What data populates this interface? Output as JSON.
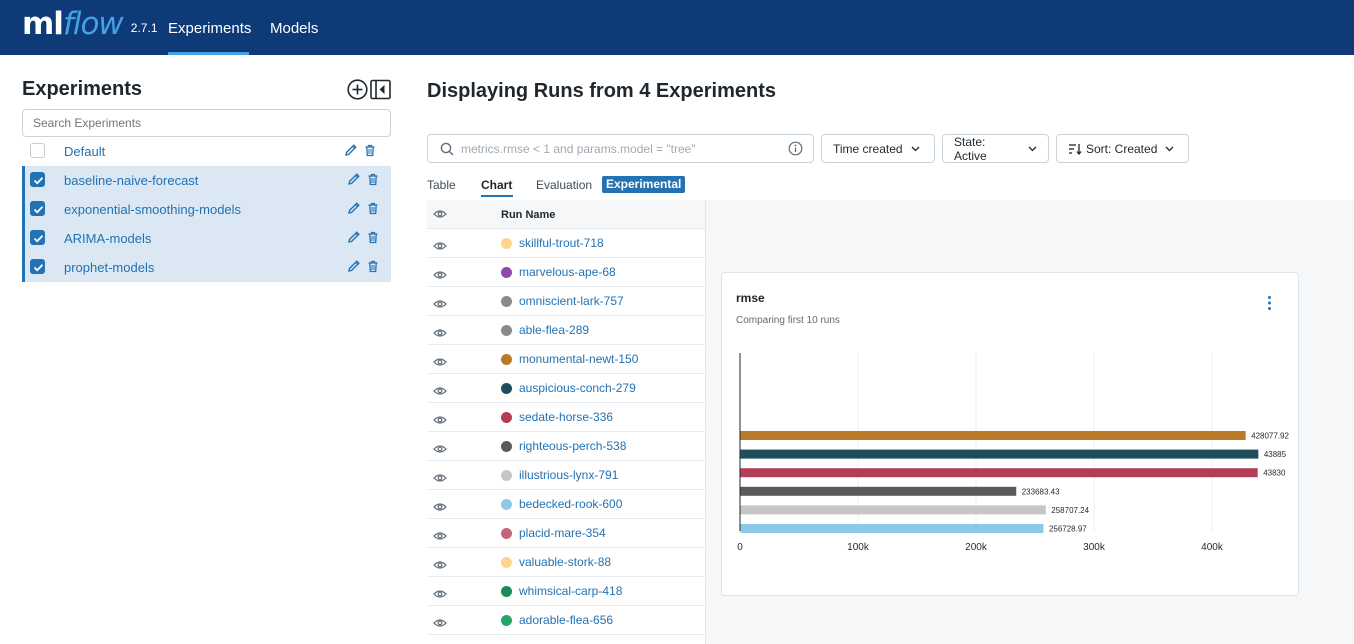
{
  "app": {
    "logo_ml": "ml",
    "logo_flow": "flow",
    "version": "2.7.1"
  },
  "nav": {
    "experiments": "Experiments",
    "models": "Models"
  },
  "sidebar": {
    "title": "Experiments",
    "search_placeholder": "Search Experiments",
    "experiments": [
      {
        "name": "Default",
        "checked": false
      },
      {
        "name": "baseline-naive-forecast",
        "checked": true
      },
      {
        "name": "exponential-smoothing-models",
        "checked": true
      },
      {
        "name": "ARIMA-models",
        "checked": true
      },
      {
        "name": "prophet-models",
        "checked": true
      }
    ]
  },
  "main": {
    "title": "Displaying Runs from 4 Experiments",
    "filter_placeholder": "metrics.rmse < 1 and params.model = \"tree\"",
    "dropdowns": {
      "time": "Time created",
      "state": "State: Active",
      "sort": "Sort: Created"
    },
    "tabs": {
      "table": "Table",
      "chart": "Chart",
      "evaluation": "Evaluation",
      "experimental": "Experimental"
    }
  },
  "runs": {
    "column_header": "Run Name",
    "rows": [
      {
        "name": "skillful-trout-718",
        "color": "#fdd591"
      },
      {
        "name": "marvelous-ape-68",
        "color": "#8d4aa8"
      },
      {
        "name": "omniscient-lark-757",
        "color": "#8a8a8a"
      },
      {
        "name": "able-flea-289",
        "color": "#8a8a8a"
      },
      {
        "name": "monumental-newt-150",
        "color": "#b97a27"
      },
      {
        "name": "auspicious-conch-279",
        "color": "#1f4d5c"
      },
      {
        "name": "sedate-horse-336",
        "color": "#b33d55"
      },
      {
        "name": "righteous-perch-538",
        "color": "#5a5a5a"
      },
      {
        "name": "illustrious-lynx-791",
        "color": "#c6c6c6"
      },
      {
        "name": "bedecked-rook-600",
        "color": "#8ec8e8"
      },
      {
        "name": "placid-mare-354",
        "color": "#c0687a"
      },
      {
        "name": "valuable-stork-88",
        "color": "#fdd591"
      },
      {
        "name": "whimsical-carp-418",
        "color": "#1a8a57"
      },
      {
        "name": "adorable-flea-656",
        "color": "#22a869"
      }
    ]
  },
  "chart_card": {
    "title": "rmse",
    "subtitle": "Comparing first 10 runs"
  },
  "chart_data": {
    "type": "bar",
    "orientation": "horizontal",
    "title": "rmse",
    "subtitle": "Comparing first 10 runs",
    "xlim": [
      0,
      450000
    ],
    "xticks": [
      0,
      100000,
      200000,
      300000,
      400000
    ],
    "xtick_labels": [
      "0",
      "100k",
      "200k",
      "300k",
      "400k"
    ],
    "grid": true,
    "bars": [
      {
        "value": 428077.92,
        "label": "428077.92",
        "color": "#b97a27"
      },
      {
        "value": 438850,
        "label": "43885",
        "color": "#1f4d5c"
      },
      {
        "value": 438300,
        "label": "43830",
        "color": "#b33d55"
      },
      {
        "value": 233683.43,
        "label": "233683.43",
        "color": "#5a5a5a"
      },
      {
        "value": 258707.24,
        "label": "258707.24",
        "color": "#c6c6c6"
      },
      {
        "value": 256728.97,
        "label": "256728.97",
        "color": "#8ec8e8"
      }
    ]
  }
}
